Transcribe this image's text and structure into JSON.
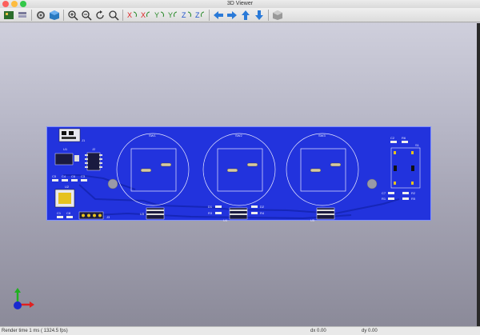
{
  "window": {
    "title": "3D Viewer"
  },
  "toolbar": {
    "icons": [
      "pcb-icon",
      "layers-icon",
      "settings-icon",
      "box-3d-icon",
      "zoom-in-icon",
      "zoom-out-icon",
      "redraw-icon",
      "zoom-fit-icon",
      "rotate-x-cw-icon",
      "rotate-x-ccw-icon",
      "rotate-y-cw-icon",
      "rotate-y-ccw-icon",
      "rotate-z-cw-icon",
      "rotate-z-ccw-icon",
      "pan-left-icon",
      "pan-right-icon",
      "pan-up-icon",
      "pan-down-icon",
      "ortho-box-icon"
    ]
  },
  "board": {
    "labels": {
      "j1": "J1",
      "u1": "U1",
      "j2": "J2",
      "u2": "U2",
      "c5": "C5",
      "c4": "C4",
      "c6": "C6",
      "c3": "C3",
      "c1": "C1",
      "c8": "C8",
      "j3": "J3",
      "sw1": "SW1",
      "sw2": "SW2",
      "sw3": "SW3",
      "u3": "U3",
      "u4": "U4",
      "u5": "U5",
      "d1": "D1",
      "r3": "R3",
      "d2": "D2",
      "r4": "R4",
      "c2": "C2",
      "r6": "R6",
      "s1": "S1",
      "c7": "C7",
      "r2": "R2",
      "r1": "R1",
      "r5": "R5"
    }
  },
  "status": {
    "render": "Render time 1 ms ( 1324.5 fps)",
    "dx": "dx 0.00",
    "dy": "dy 0.00"
  },
  "colors": {
    "board": "#2233dd",
    "viewport_top": "#cfcfdc",
    "viewport_bottom": "#8b8a99"
  }
}
